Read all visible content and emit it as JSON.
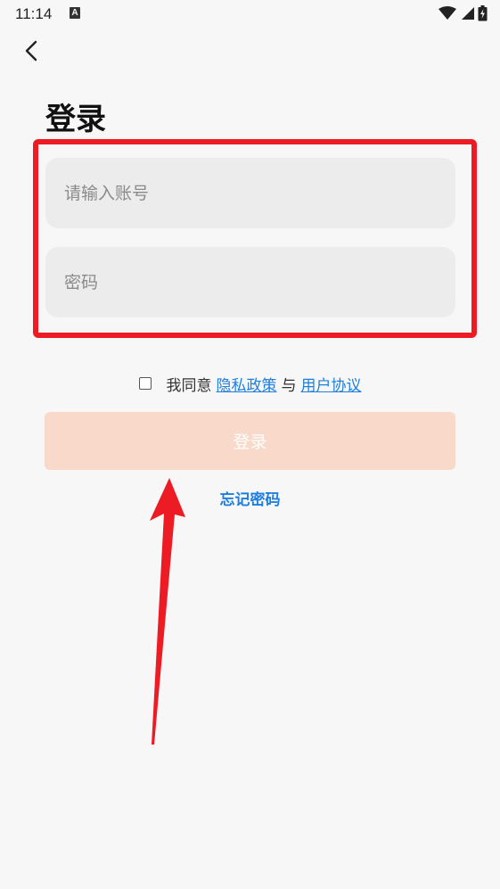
{
  "status_bar": {
    "time": "11:14",
    "badge": "A"
  },
  "login": {
    "title": "登录",
    "account_placeholder": "请输入账号",
    "password_placeholder": "密码",
    "agree_prefix": "我同意",
    "privacy_link": "隐私政策",
    "and_text": "与",
    "terms_link": "用户协议",
    "login_button": "登录",
    "forgot_password": "忘记密码"
  },
  "icons": {
    "back": "chevron-left-icon",
    "wifi": "wifi-icon",
    "signal": "cellular-signal-icon",
    "battery": "battery-icon"
  },
  "colors": {
    "accent_link": "#1e7fe0",
    "login_button_bg": "#f9d9c9",
    "annotation_red": "#ed1c24",
    "input_bg": "#ececec",
    "page_bg": "#f7f7f7"
  }
}
